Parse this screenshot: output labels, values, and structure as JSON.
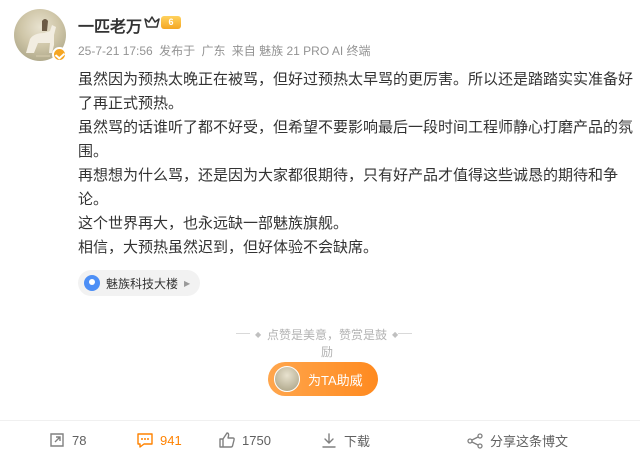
{
  "post": {
    "username": "一匹老万",
    "level_badge": "6",
    "meta": {
      "time": "25-7-21 17:56",
      "source_prefix": "发布于",
      "region": "广东",
      "device": "来自 魅族 21 PRO AI 终端"
    },
    "paragraphs": [
      "虽然因为预热太晚正在被骂，但好过预热太早骂的更厉害。所以还是踏踏实实准备好了再正式预热。",
      "虽然骂的话谁听了都不好受，但希望不要影响最后一段时间工程师静心打磨产品的氛围。",
      "再想想为什么骂，还是因为大家都很期待，只有好产品才值得这些诚恳的期待和争论。",
      "这个世界再大，也永远缺一部魅族旗舰。",
      "相信，大预热虽然迟到，但好体验不会缺席。"
    ],
    "location_tag": "魅族科技大楼",
    "divider_text": "点赞是美意，赞赏是鼓励",
    "cheer_button": "为TA助威"
  },
  "footer": {
    "repost_count": "78",
    "comment_count": "941",
    "like_count": "1750",
    "download_label": "下载",
    "share_label": "分享这条博文"
  },
  "colors": {
    "accent": "#ff8200",
    "location_icon": "#4d8ff6",
    "badge": "#f5a623"
  }
}
